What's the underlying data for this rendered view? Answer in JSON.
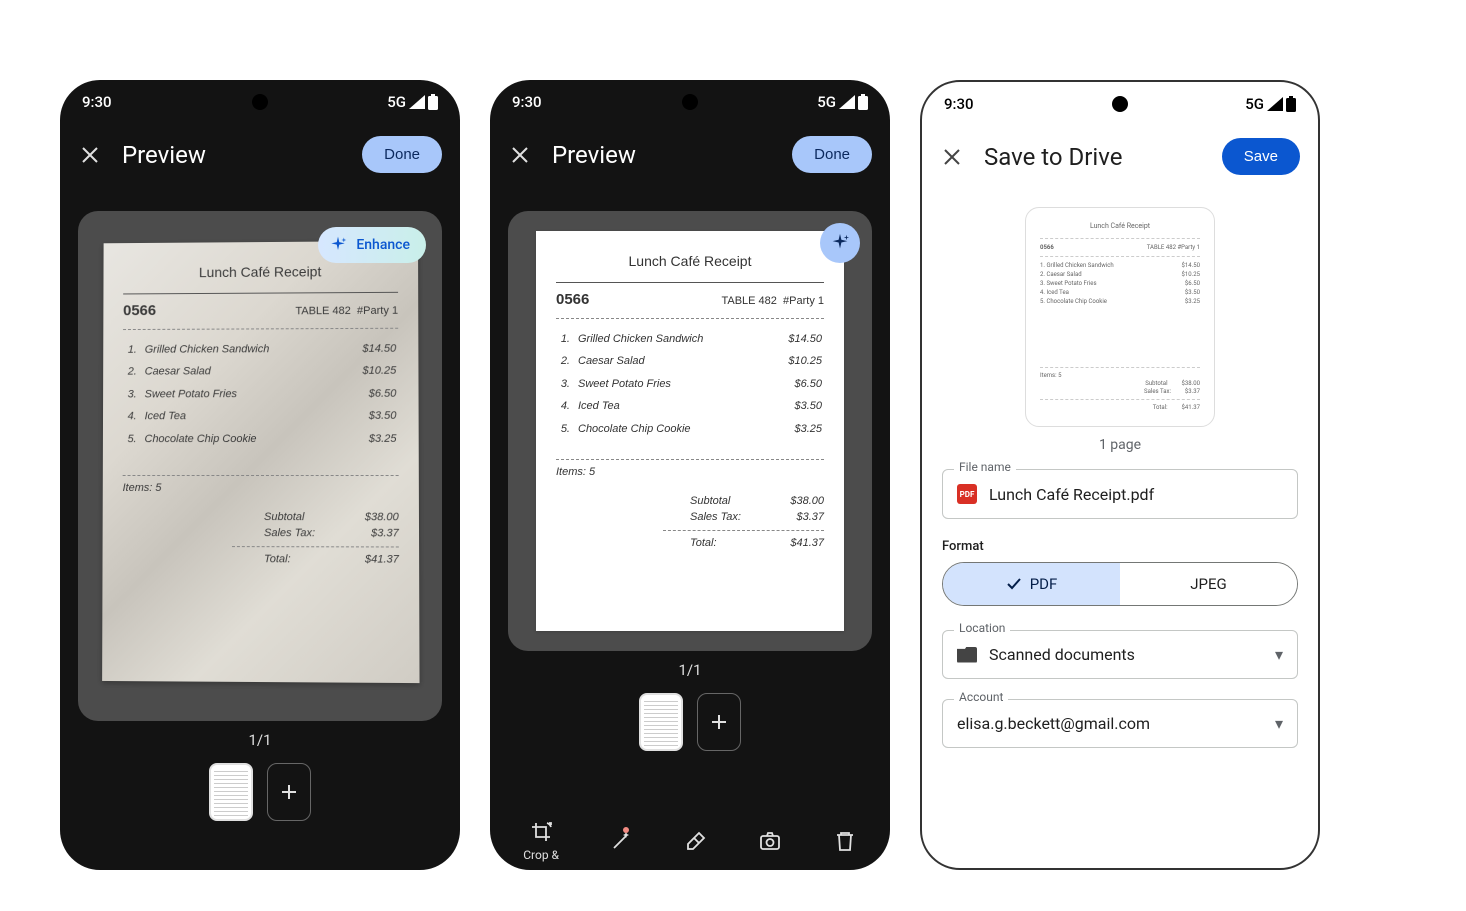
{
  "status": {
    "time": "9:30",
    "network": "5G"
  },
  "screen1": {
    "title": "Preview",
    "done": "Done",
    "enhance": "Enhance",
    "page_indicator": "1/1"
  },
  "screen2": {
    "title": "Preview",
    "done": "Done",
    "page_indicator": "1/1",
    "toolbar": {
      "crop": "Crop &",
      "filter": "",
      "erase": "",
      "retake": "",
      "delete": ""
    }
  },
  "screen3": {
    "title": "Save to Drive",
    "save": "Save",
    "page_count": "1 page",
    "filename_label": "File name",
    "filename_value": "Lunch Café Receipt.pdf",
    "format_label": "Format",
    "format_pdf": "PDF",
    "format_jpeg": "JPEG",
    "location_label": "Location",
    "location_value": "Scanned documents",
    "account_label": "Account",
    "account_value": "elisa.g.beckett@gmail.com",
    "pdf_badge": "PDF"
  },
  "receipt": {
    "title": "Lunch Café Receipt",
    "order_no": "0566",
    "table": "TABLE  482",
    "party": "#Party 1",
    "items_count_label": "Items: 5",
    "items": [
      {
        "n": "1.",
        "name": "Grilled Chicken Sandwich",
        "price": "$14.50"
      },
      {
        "n": "2.",
        "name": "Caesar Salad",
        "price": "$10.25"
      },
      {
        "n": "3.",
        "name": "Sweet Potato Fries",
        "price": "$6.50"
      },
      {
        "n": "4.",
        "name": "Iced Tea",
        "price": "$3.50"
      },
      {
        "n": "5.",
        "name": "Chocolate Chip Cookie",
        "price": "$3.25"
      }
    ],
    "subtotal_label": "Subtotal",
    "subtotal": "$38.00",
    "tax_label": "Sales Tax:",
    "tax": "$3.37",
    "total_label": "Total:",
    "total": "$41.37"
  }
}
